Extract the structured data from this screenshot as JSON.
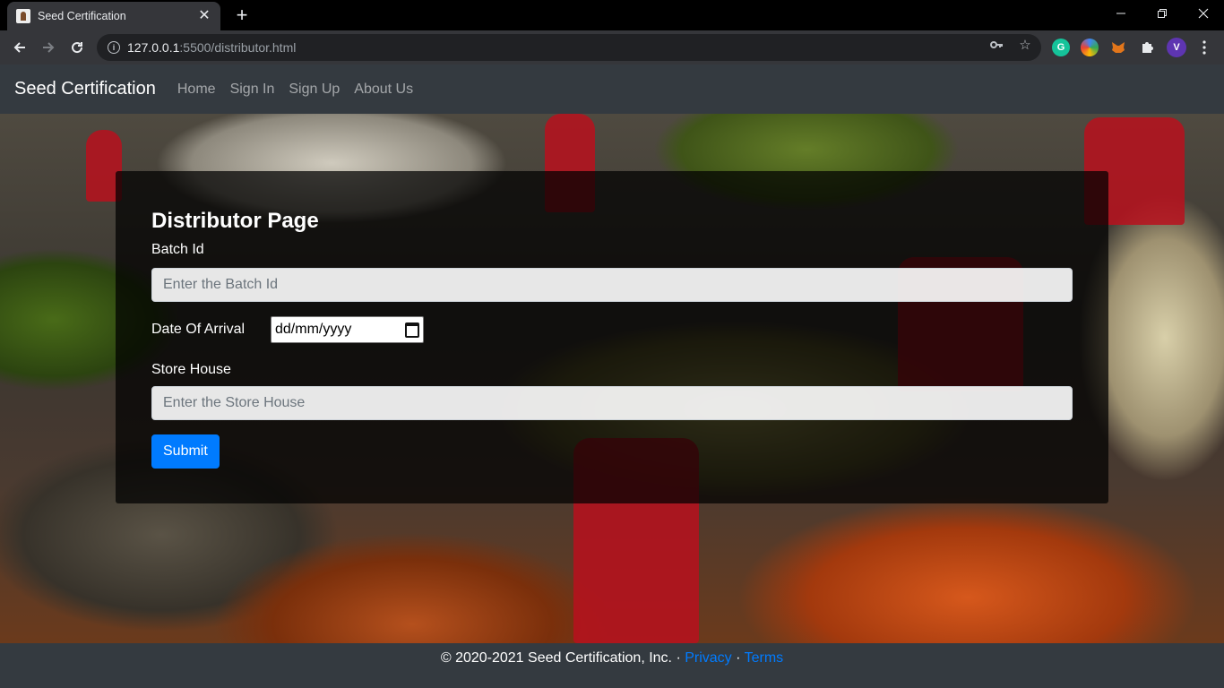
{
  "browser": {
    "tab_title": "Seed Certification",
    "tab_close_glyph": "✕",
    "new_tab_glyph": "+",
    "url_host": "127.0.0.1",
    "url_rest": ":5500/distributor.html",
    "profile_initial": "V",
    "icons": [
      "back-icon",
      "forward-icon",
      "reload-icon",
      "site-info-icon",
      "key-icon",
      "bookmark-star-icon",
      "grammarly-icon",
      "extension-icon",
      "metamask-icon",
      "puzzle-icon",
      "profile-icon",
      "menu-icon"
    ]
  },
  "nav": {
    "brand": "Seed Certification",
    "links": [
      "Home",
      "Sign In",
      "Sign Up",
      "About Us"
    ]
  },
  "form": {
    "title": "Distributor Page",
    "batch_label": "Batch Id",
    "batch_placeholder": "Enter the Batch Id",
    "date_label": "Date Of Arrival",
    "date_value": "dd/mm/yyyy",
    "store_label": "Store House",
    "store_placeholder": "Enter the Store House",
    "submit_label": "Submit"
  },
  "footer": {
    "copyright": "© 2020-2021 Seed Certification, Inc. · ",
    "privacy": "Privacy",
    "separator": " · ",
    "terms": "Terms"
  },
  "colors": {
    "navbar": "#343a40",
    "primary": "#007bff",
    "card_overlay": "rgba(0,0,0,0.72)"
  }
}
